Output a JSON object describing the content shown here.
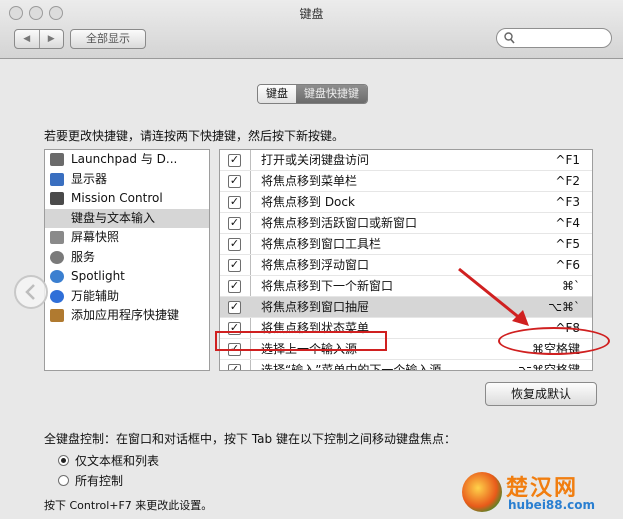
{
  "window": {
    "title": "键盘"
  },
  "toolbar": {
    "show_all": "全部显示",
    "search_placeholder": ""
  },
  "tabs": [
    {
      "label": "键盘",
      "active": true
    },
    {
      "label": "键盘快捷键",
      "active": false
    }
  ],
  "instruction": "若要更改快捷键，请连按两下快捷键，然后按下新按键。",
  "categories": [
    {
      "label": "Launchpad 与 D...",
      "icon": "launchpad-icon",
      "color": "#6b6b6b"
    },
    {
      "label": "显示器",
      "icon": "display-icon",
      "color": "#3a6fc0"
    },
    {
      "label": "Mission Control",
      "icon": "mission-control-icon",
      "color": "#4a4a4a"
    },
    {
      "label": "键盘与文本输入",
      "icon": "keyboard-icon",
      "color": "#d6d6d6",
      "selected": true
    },
    {
      "label": "屏幕快照",
      "icon": "screenshot-icon",
      "color": "#8a8a8a"
    },
    {
      "label": "服务",
      "icon": "services-icon",
      "color": "#7a7a7a"
    },
    {
      "label": "Spotlight",
      "icon": "spotlight-icon",
      "color": "#3b7fd0"
    },
    {
      "label": "万能辅助",
      "icon": "accessibility-icon",
      "color": "#2f6fd8"
    },
    {
      "label": "添加应用程序快捷键",
      "icon": "app-shortcut-icon",
      "color": "#b07a30"
    }
  ],
  "shortcuts": [
    {
      "label": "打开或关闭键盘访问",
      "key": "^F1",
      "checked": true
    },
    {
      "label": "将焦点移到菜单栏",
      "key": "^F2",
      "checked": true
    },
    {
      "label": "将焦点移到 Dock",
      "key": "^F3",
      "checked": true
    },
    {
      "label": "将焦点移到活跃窗口或新窗口",
      "key": "^F4",
      "checked": true
    },
    {
      "label": "将焦点移到窗口工具栏",
      "key": "^F5",
      "checked": true
    },
    {
      "label": "将焦点移到浮动窗口",
      "key": "^F6",
      "checked": true
    },
    {
      "label": "将焦点移到下一个新窗口",
      "key": "⌘`",
      "checked": true
    },
    {
      "label": "将焦点移到窗口抽屉",
      "key": "⌥⌘`",
      "checked": true,
      "selected": true
    },
    {
      "label": "将焦点移到状态菜单",
      "key": "^F8",
      "checked": true
    },
    {
      "label": "选择上一个输入源",
      "key": "⌘空格键",
      "checked": true
    },
    {
      "label": "选择“输入”菜单中的下一个输入源",
      "key": "⌥⌘空格键",
      "checked": true
    }
  ],
  "reset_button": "恢复成默认",
  "full_keyboard": {
    "heading": "全键盘控制：在窗口和对话框中，按下 Tab 键在以下控制之间移动键盘焦点：",
    "options": [
      {
        "label": "仅文本框和列表",
        "selected": true
      },
      {
        "label": "所有控制",
        "selected": false
      }
    ],
    "note": "按下 Control+F7 来更改此设置。"
  },
  "watermark": {
    "title": "楚汉网",
    "url": "hubei88.com"
  },
  "colors": {
    "highlight": "#d02020",
    "watermark_orange": "#f17e10",
    "watermark_blue": "#2a7fd1"
  }
}
